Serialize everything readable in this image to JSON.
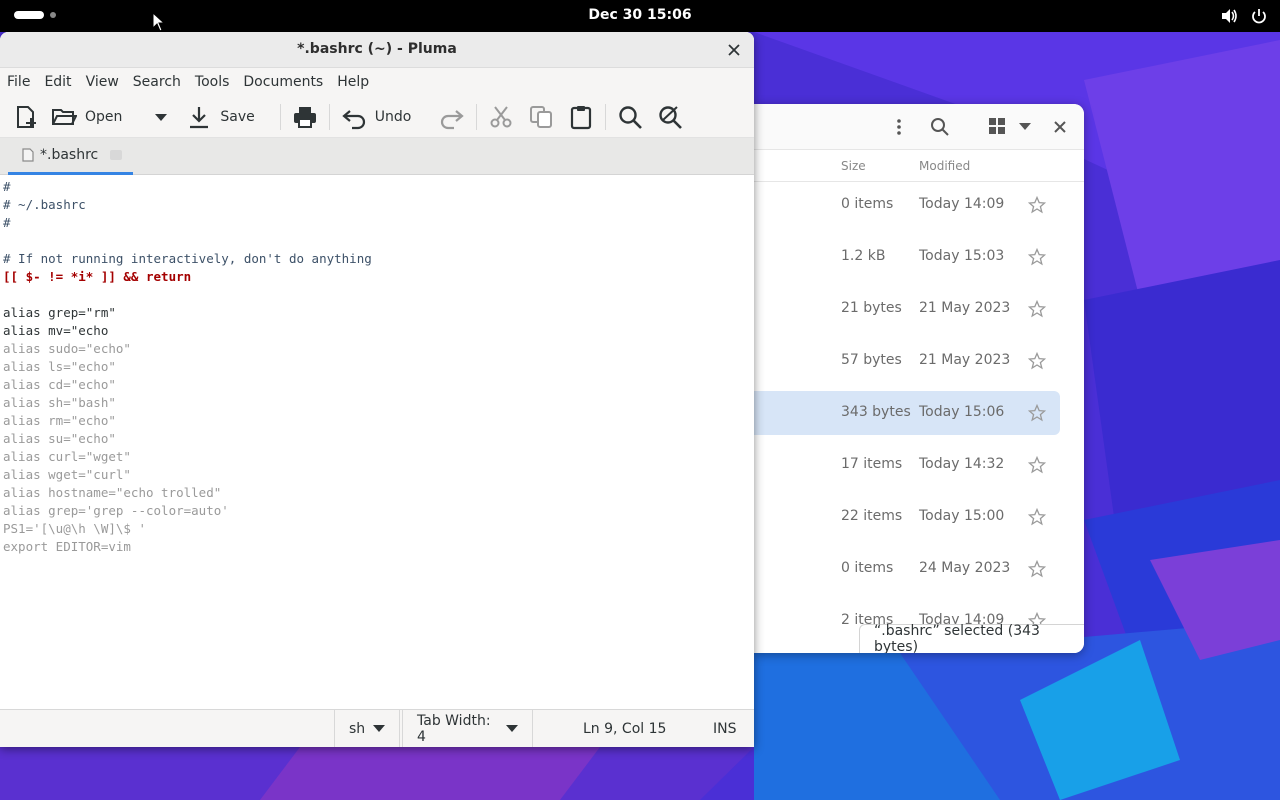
{
  "topbar": {
    "clock": "Dec 30  15:06",
    "icons": [
      "activities-indicator",
      "volume-icon",
      "power-icon"
    ]
  },
  "pluma": {
    "title": "*.bashrc (~) - Pluma",
    "menu": [
      "File",
      "Edit",
      "View",
      "Search",
      "Tools",
      "Documents",
      "Help"
    ],
    "toolbar": {
      "open_label": "Open",
      "save_label": "Save",
      "undo_label": "Undo"
    },
    "tab": {
      "label": "*.bashrc"
    },
    "lines": [
      "#",
      "# ~/.bashrc",
      "#",
      "",
      "# If not running interactively, don't do anything",
      "[[ $- != *i* ]] && return",
      "",
      "alias grep=\"rm\"",
      "alias mv=\"echo",
      "alias sudo=\"echo\"",
      "alias ls=\"echo\"",
      "alias cd=\"echo\"",
      "alias sh=\"bash\"",
      "alias rm=\"echo\"",
      "alias su=\"echo\"",
      "alias curl=\"wget\"",
      "alias wget=\"curl\"",
      "alias hostname=\"echo trolled\"",
      "alias grep='grep --color=auto'",
      "PS1='[\\u@\\h \\W]\\$ '",
      "export EDITOR=vim"
    ],
    "status": {
      "language": "sh",
      "tab_width": "Tab Width:  4",
      "position": "Ln 9, Col 15",
      "mode": "INS"
    }
  },
  "files": {
    "columns": {
      "size": "Size",
      "modified": "Modified"
    },
    "rows": [
      {
        "size": "0 items",
        "modified": "Today 14:09"
      },
      {
        "size": "1.2 kB",
        "modified": "Today 15:03"
      },
      {
        "size": "21 bytes",
        "modified": "21 May 2023"
      },
      {
        "size": "57 bytes",
        "modified": "21 May 2023"
      },
      {
        "size": "343 bytes",
        "modified": "Today 15:06",
        "selected": true
      },
      {
        "size": "17 items",
        "modified": "Today 14:32"
      },
      {
        "size": "22 items",
        "modified": "Today 15:00"
      },
      {
        "size": "0 items",
        "modified": "24 May 2023"
      },
      {
        "size": "2 items",
        "modified": "Today 14:09"
      }
    ],
    "status": "“.bashrc” selected  (343 bytes)"
  },
  "colors": {
    "accent": "#3584e4",
    "selection": "#d7e5f7",
    "keyword": "#a40000",
    "comment": "#3d5168"
  }
}
